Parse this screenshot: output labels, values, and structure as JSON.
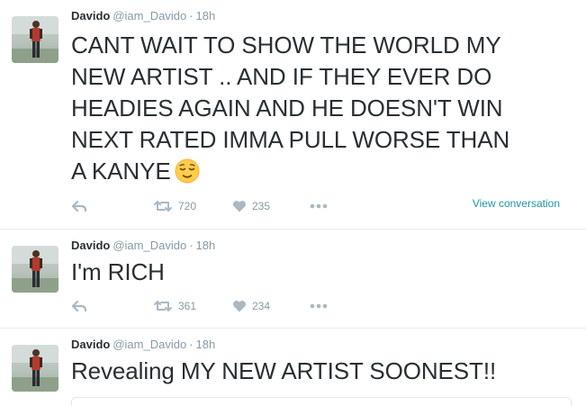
{
  "tweets": [
    {
      "name": "Davido",
      "handle": "@iam_Davido",
      "separator": "·",
      "time": "18h",
      "lines": [
        "CANT WAIT TO SHOW THE WORLD MY",
        "NEW ARTIST .. AND IF THEY EVER DO",
        "HEADIES AGAIN AND HE DOESN'T WIN",
        "NEXT RATED IMMA PULL WORSE THAN",
        "A KANYE"
      ],
      "emoji": "relieved-face",
      "retweets": "720",
      "likes": "235",
      "view_conversation": "View conversation"
    },
    {
      "name": "Davido",
      "handle": "@iam_Davido",
      "separator": "·",
      "time": "18h",
      "lines": [
        "I'm RICH"
      ],
      "retweets": "361",
      "likes": "234"
    },
    {
      "name": "Davido",
      "handle": "@iam_Davido",
      "separator": "·",
      "time": "18h",
      "lines": [
        "Revealing MY NEW ARTIST SOONEST!!"
      ]
    }
  ],
  "colors": {
    "text": "#292f33",
    "secondary": "#8899a6",
    "icon": "#aab8c2",
    "link": "#1b95a0",
    "divider": "#e6ecf0"
  },
  "icons": [
    "reply-icon",
    "retweet-icon",
    "like-icon",
    "more-icon"
  ]
}
